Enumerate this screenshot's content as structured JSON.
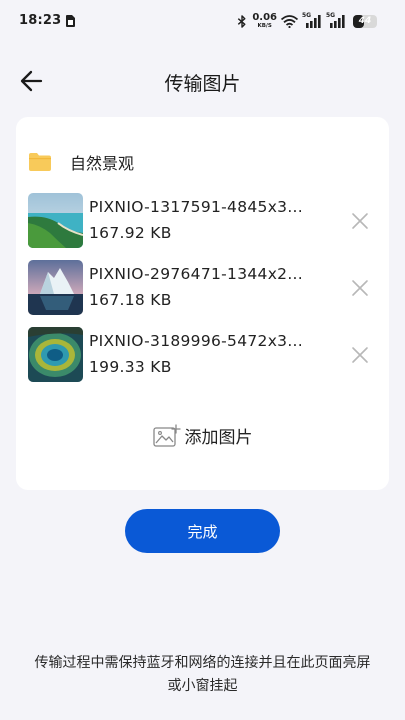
{
  "status_bar": {
    "time": "18:23",
    "net_speed_value": "0.06",
    "net_speed_unit": "KB/S",
    "signal1_label": "5G",
    "signal2_label": "5G",
    "battery_level": "44",
    "battery_fraction": 0.44
  },
  "header": {
    "title": "传输图片"
  },
  "album": {
    "name": "自然景观"
  },
  "files": [
    {
      "name": "PIXNIO-1317591-4845x3...",
      "size": "167.92 KB"
    },
    {
      "name": "PIXNIO-2976471-1344x2...",
      "size": "167.18 KB"
    },
    {
      "name": "PIXNIO-3189996-5472x3...",
      "size": "199.33 KB"
    }
  ],
  "add_label": "添加图片",
  "done_label": "完成",
  "footer_note": "传输过程中需保持蓝牙和网络的连接并且在此页面亮屏或小窗挂起",
  "colors": {
    "accent": "#0a59d6",
    "background": "#f4f4f9",
    "folder": "#f8ca5a"
  }
}
